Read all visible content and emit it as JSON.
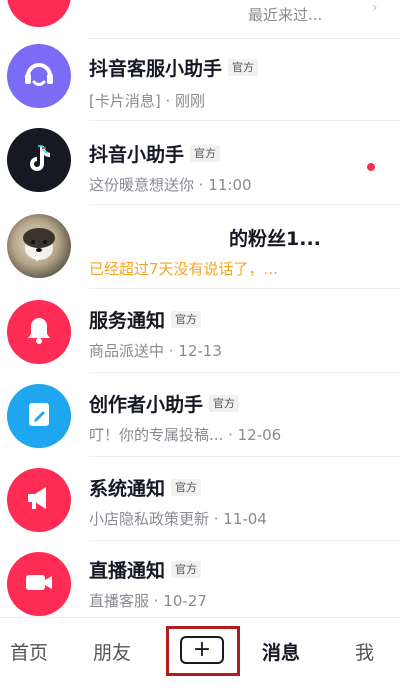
{
  "messages": [
    {
      "title": "",
      "badge": "",
      "subtitle": "最近来过...",
      "avatar_icon": "heart-icon",
      "avatar_color": "#fe2c55"
    },
    {
      "title": "抖音客服小助手",
      "badge": "官方",
      "subtitle": "[卡片消息] · 刚刚",
      "avatar_icon": "headset-icon",
      "avatar_color": "#7b6cf6"
    },
    {
      "title": "抖音小助手",
      "badge": "官方",
      "subtitle": "这份暖意想送你 · 11:00",
      "avatar_icon": "tiktok-logo-icon",
      "avatar_color": "#161823",
      "unread": true
    },
    {
      "title": "的粉丝1...",
      "badge": "",
      "subtitle": "已经超过7天没有说话了，...",
      "avatar_icon": "dog-photo-avatar",
      "avatar_color": "#9c8f7a",
      "subtitle_color": "#f5a623"
    },
    {
      "title": "服务通知",
      "badge": "官方",
      "subtitle": "商品派送中 · 12-13",
      "avatar_icon": "bell-icon",
      "avatar_color": "#fe2c55"
    },
    {
      "title": "创作者小助手",
      "badge": "官方",
      "subtitle": "叮！你的专属投稿... · 12-06",
      "avatar_icon": "edit-icon",
      "avatar_color": "#1ea6ee"
    },
    {
      "title": "系统通知",
      "badge": "官方",
      "subtitle": "小店隐私政策更新 · 11-04",
      "avatar_icon": "megaphone-icon",
      "avatar_color": "#fe2c55"
    },
    {
      "title": "直播通知",
      "badge": "官方",
      "subtitle": "直播客服 · 10-27",
      "avatar_icon": "video-camera-icon",
      "avatar_color": "#fe2c55"
    }
  ],
  "tabbar": {
    "home": "首页",
    "friends": "朋友",
    "plus": "+",
    "messages": "消息",
    "me": "我"
  },
  "colors": {
    "accent": "#fe2c55",
    "highlight_border": "#b11d1d"
  }
}
